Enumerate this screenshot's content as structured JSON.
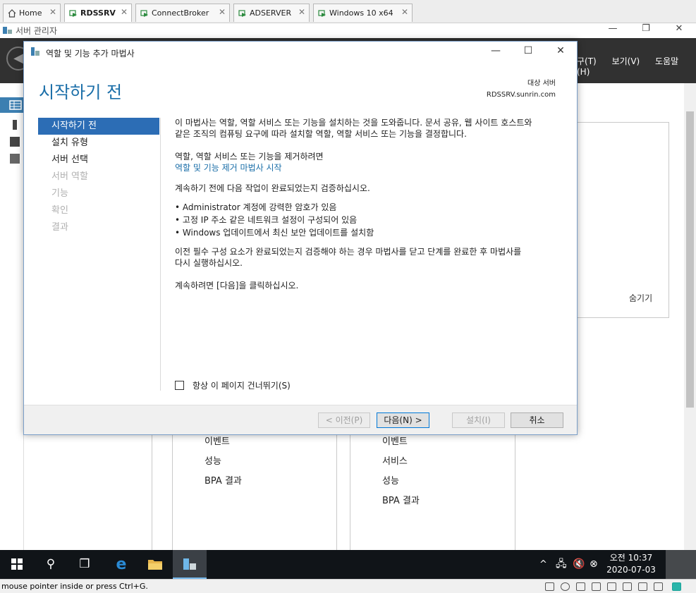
{
  "vm_tabs": [
    {
      "label": "Home",
      "icon": "home-icon"
    },
    {
      "label": "RDSSRV",
      "icon": "vm-icon",
      "active": true
    },
    {
      "label": "ConnectBroker",
      "icon": "vm-icon"
    },
    {
      "label": "ADSERVER",
      "icon": "vm-icon"
    },
    {
      "label": "Windows 10 x64",
      "icon": "vm-icon"
    }
  ],
  "server_manager": {
    "title": "서버 관리자",
    "menus": [
      "구(T)",
      "보기(V)",
      "도움말(H)"
    ],
    "hide_label": "숨기기",
    "left_card_links": [
      "이벤트",
      "성능",
      "BPA 결과"
    ],
    "right_card_links": [
      "이벤트",
      "서비스",
      "성능",
      "BPA 결과"
    ]
  },
  "dialog": {
    "title": "역할 및 기능 추가 마법사",
    "heading": "시작하기 전",
    "destination_label": "대상 서버",
    "destination_server": "RDSSRV.sunrin.com",
    "nav": [
      {
        "label": "시작하기 전",
        "state": "selected"
      },
      {
        "label": "설치 유형",
        "state": "enabled"
      },
      {
        "label": "서버 선택",
        "state": "enabled"
      },
      {
        "label": "서버 역할",
        "state": "disabled"
      },
      {
        "label": "기능",
        "state": "disabled"
      },
      {
        "label": "확인",
        "state": "disabled"
      },
      {
        "label": "결과",
        "state": "disabled"
      }
    ],
    "intro_line1": "이 마법사는 역할, 역할 서비스 또는 기능을 설치하는 것을 도와줍니다. 문서 공유, 웹 사이트 호스트와",
    "intro_line2": "같은 조직의 컴퓨팅 요구에 따라 설치할 역할, 역할 서비스 또는 기능을 결정합니다.",
    "remove_text": "역할, 역할 서비스 또는 기능을 제거하려면",
    "remove_link": "역할 및 기능 제거 마법사 시작",
    "verify_text": "계속하기 전에 다음 작업이 완료되었는지 검증하십시오.",
    "bullets": [
      "Administrator 계정에 강력한 암호가 있음",
      "고정 IP 주소 같은 네트워크 설정이 구성되어 있음",
      "Windows 업데이트에서 최신 보안 업데이트를 설치함"
    ],
    "prereq_line1": "이전 필수 구성 요소가 완료되었는지 검증해야 하는 경우 마법사를 닫고 단계를 완료한 후 마법사를",
    "prereq_line2": "다시 실행하십시오.",
    "continue_text": "계속하려면 [다음]을 클릭하십시오.",
    "skip_checkbox": "항상 이 페이지 건너뛰기(S)",
    "buttons": {
      "prev": "< 이전(P)",
      "next": "다음(N) >",
      "install": "설치(I)",
      "cancel": "취소"
    }
  },
  "taskbar": {
    "time": "오전 10:37",
    "date": "2020-07-03"
  },
  "statusbar": {
    "message": "mouse pointer inside or press Ctrl+G."
  },
  "colors": {
    "accent": "#2c6db5",
    "heading": "#1a6ea8",
    "header_bg": "#313131",
    "taskbar_bg": "#101418"
  }
}
